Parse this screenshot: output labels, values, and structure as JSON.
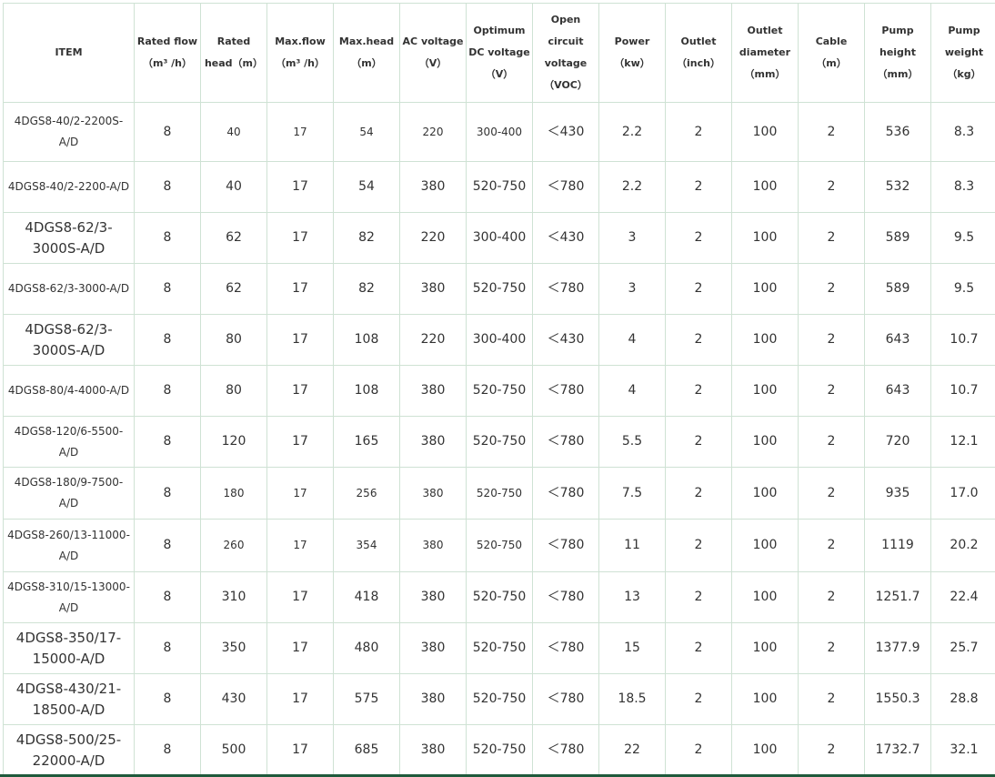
{
  "columns": [
    "ITEM",
    "Rated flow\n（m³ /h）",
    "Rated head（m）",
    "Max.flow\n（m³ /h）",
    "Max.head\n（m）",
    "AC voltage\n（V）",
    "Optimum DC voltage\n（V）",
    "Open circuit voltage\n（VOC）",
    "Power\n（kw）",
    "Outlet\n（inch）",
    "Outlet diameter\n（mm）",
    "Cable\n（m）",
    "Pump height\n（mm）",
    "Pump weight\n（kg）"
  ],
  "rows": [
    [
      "4DGS8-40/2-2200S-A/D",
      "8",
      "40",
      "17",
      "54",
      "220",
      "300-400",
      "＜430",
      "2.2",
      "2",
      "100",
      "2",
      "536",
      "8.3"
    ],
    [
      "4DGS8-40/2-2200-A/D",
      "8",
      "40",
      "17",
      "54",
      "380",
      "520-750",
      "＜780",
      "2.2",
      "2",
      "100",
      "2",
      "532",
      "8.3"
    ],
    [
      "4DGS8-62/3-3000S-A/D",
      "8",
      "62",
      "17",
      "82",
      "220",
      "300-400",
      "＜430",
      "3",
      "2",
      "100",
      "2",
      "589",
      "9.5"
    ],
    [
      "4DGS8-62/3-3000-A/D",
      "8",
      "62",
      "17",
      "82",
      "380",
      "520-750",
      "＜780",
      "3",
      "2",
      "100",
      "2",
      "589",
      "9.5"
    ],
    [
      "4DGS8-62/3-3000S-A/D",
      "8",
      "80",
      "17",
      "108",
      "220",
      "300-400",
      "＜430",
      "4",
      "2",
      "100",
      "2",
      "643",
      "10.7"
    ],
    [
      "4DGS8-80/4-4000-A/D",
      "8",
      "80",
      "17",
      "108",
      "380",
      "520-750",
      "＜780",
      "4",
      "2",
      "100",
      "2",
      "643",
      "10.7"
    ],
    [
      "4DGS8-120/6-5500-A/D",
      "8",
      "120",
      "17",
      "165",
      "380",
      "520-750",
      "＜780",
      "5.5",
      "2",
      "100",
      "2",
      "720",
      "12.1"
    ],
    [
      "4DGS8-180/9-7500-A/D",
      "8",
      "180",
      "17",
      "256",
      "380",
      "520-750",
      "＜780",
      "7.5",
      "2",
      "100",
      "2",
      "935",
      "17.0"
    ],
    [
      "4DGS8-260/13-11000-A/D",
      "8",
      "260",
      "17",
      "354",
      "380",
      "520-750",
      "＜780",
      "11",
      "2",
      "100",
      "2",
      "1119",
      "20.2"
    ],
    [
      "4DGS8-310/15-13000-A/D",
      "8",
      "310",
      "17",
      "418",
      "380",
      "520-750",
      "＜780",
      "13",
      "2",
      "100",
      "2",
      "1251.7",
      "22.4"
    ],
    [
      "4DGS8-350/17-15000-A/D",
      "8",
      "350",
      "17",
      "480",
      "380",
      "520-750",
      "＜780",
      "15",
      "2",
      "100",
      "2",
      "1377.9",
      "25.7"
    ],
    [
      "4DGS8-430/21-18500-A/D",
      "8",
      "430",
      "17",
      "575",
      "380",
      "520-750",
      "＜780",
      "18.5",
      "2",
      "100",
      "2",
      "1550.3",
      "28.8"
    ],
    [
      "4DGS8-500/25-22000-A/D",
      "8",
      "500",
      "17",
      "685",
      "380",
      "520-750",
      "＜780",
      "22",
      "2",
      "100",
      "2",
      "1732.7",
      "32.1"
    ]
  ],
  "colors": {
    "border": "#cfe2d4",
    "text": "#333333",
    "accent_bar": "#1f5a3c"
  }
}
